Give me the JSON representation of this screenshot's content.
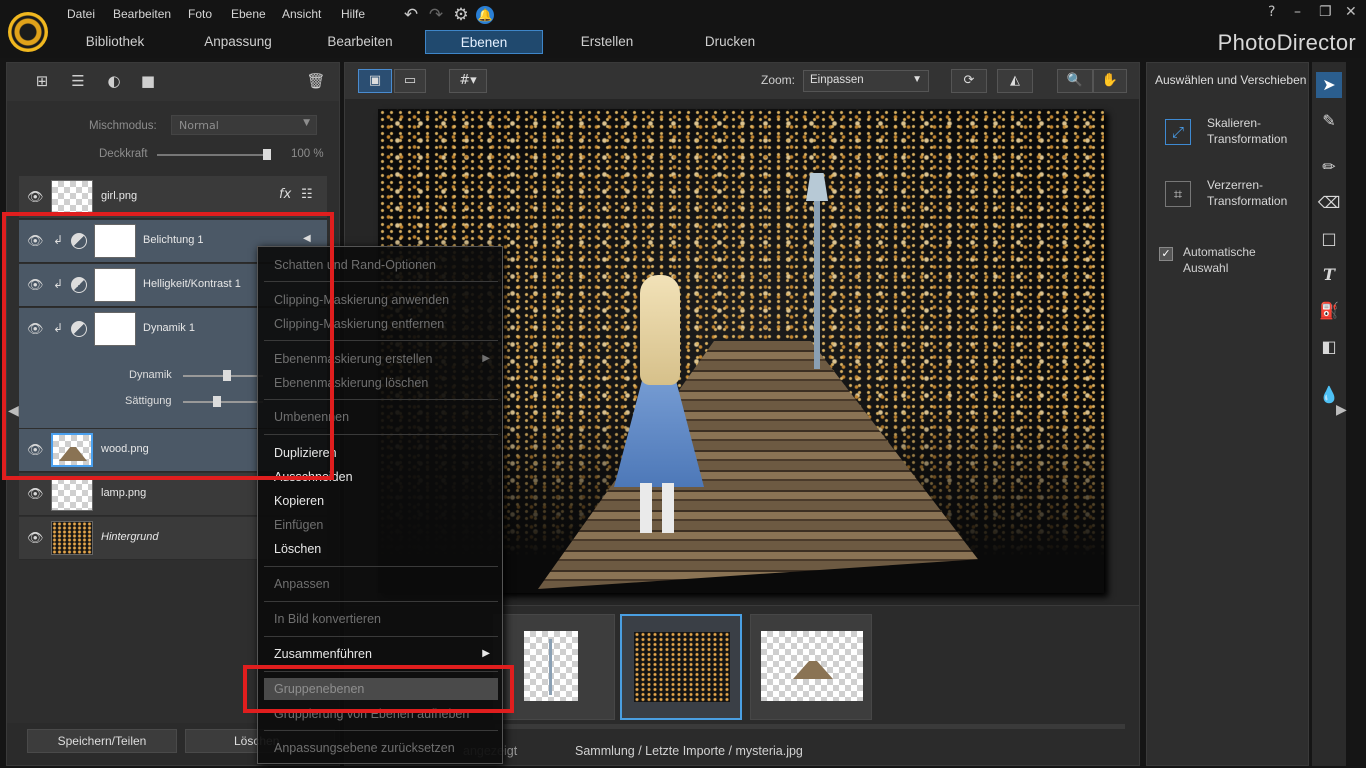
{
  "menubar": {
    "items": [
      "Datei",
      "Bearbeiten",
      "Foto",
      "Ebene",
      "Ansicht",
      "Hilfe"
    ]
  },
  "window": {
    "help": "?",
    "minimize": "–",
    "restore": "❐",
    "close": "✕"
  },
  "tabs": [
    {
      "label": "Bibliothek"
    },
    {
      "label": "Anpassung"
    },
    {
      "label": "Bearbeiten"
    },
    {
      "label": "Ebenen",
      "active": true
    },
    {
      "label": "Erstellen"
    },
    {
      "label": "Drucken"
    }
  ],
  "brand": "PhotoDirector",
  "layers_panel": {
    "blend_label": "Mischmodus:",
    "blend_value": "Normal",
    "opacity_label": "Deckkraft",
    "opacity_value": "100 %",
    "opacity_fraction": 1.0,
    "layers": [
      {
        "name": "girl.png",
        "fx": "fx"
      },
      {
        "name": "Belichtung 1"
      },
      {
        "name": "Helligkeit/Kontrast 1"
      },
      {
        "name": "Dynamik 1"
      },
      {
        "name": "wood.png"
      },
      {
        "name": "lamp.png"
      },
      {
        "name": "Hintergrund"
      }
    ],
    "sliders": [
      {
        "label": "Dynamik",
        "value_fraction": 0.55
      },
      {
        "label": "Sättigung",
        "value_fraction": 0.45
      }
    ],
    "save_share": "Speichern/Teilen",
    "delete": "Löschen"
  },
  "center": {
    "zoom_label": "Zoom:",
    "zoom_value": "Einpassen",
    "gezeigt": "angezeigt",
    "path": "Sammlung / Letzte Importe / mysteria.jpg"
  },
  "context_menu": {
    "items": [
      {
        "label": "Schatten und Rand-Optionen",
        "state": "disabled"
      },
      {
        "label": "Clipping-Maskierung anwenden",
        "state": "disabled"
      },
      {
        "label": "Clipping-Maskierung entfernen",
        "state": "disabled"
      },
      {
        "label": "Ebenenmaskierung erstellen",
        "state": "disabled",
        "submenu": true
      },
      {
        "label": "Ebenenmaskierung löschen",
        "state": "disabled"
      },
      {
        "label": "Umbenennen",
        "state": "disabled"
      },
      {
        "label": "Duplizieren",
        "state": "enabled"
      },
      {
        "label": "Ausschneiden",
        "state": "enabled"
      },
      {
        "label": "Kopieren",
        "state": "enabled"
      },
      {
        "label": "Einfügen",
        "state": "disabled"
      },
      {
        "label": "Löschen",
        "state": "enabled"
      },
      {
        "label": "Anpassen",
        "state": "disabled"
      },
      {
        "label": "In Bild konvertieren",
        "state": "disabled"
      },
      {
        "label": "Zusammenführen",
        "state": "enabled",
        "submenu": true
      },
      {
        "label": "Gruppenebenen",
        "state": "highlighted"
      },
      {
        "label": "Gruppierung von Ebenen aufheben",
        "state": "disabled"
      },
      {
        "label": "Anpassungsebene zurücksetzen",
        "state": "disabled"
      }
    ]
  },
  "right_panel": {
    "title": "Auswählen und Verschieben",
    "scale": "Skalieren-\nTransformation",
    "scale_l1": "Skalieren-",
    "scale_l2": "Transformation",
    "distort_l1": "Verzerren-",
    "distort_l2": "Transformation",
    "autosel_l1": "Automatische",
    "autosel_l2": "Auswahl"
  },
  "colors": {
    "accent": "#3e86c9",
    "highlight_red": "#e01e1e",
    "selected_layer": "#4b5866"
  }
}
